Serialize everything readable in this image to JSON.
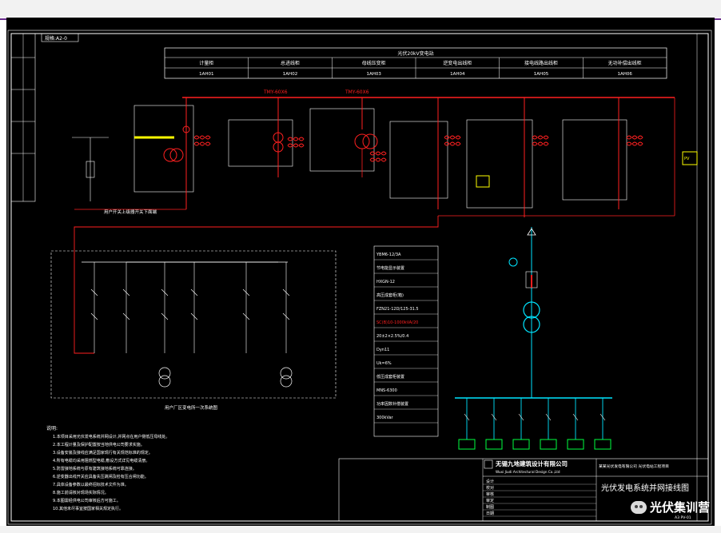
{
  "drawing": {
    "sheet_tag": "规格:A2-0",
    "header_title": "光伏20kV变电站",
    "cabinets": [
      {
        "name": "计量柜",
        "code": "1AH01"
      },
      {
        "name": "总进线柜",
        "code": "1AH02"
      },
      {
        "name": "母线压变柜",
        "code": "1AH03"
      },
      {
        "name": "逆变电出线柜",
        "code": "1AH04"
      },
      {
        "name": "接电线路出线柜",
        "code": "1AH05"
      },
      {
        "name": "无功补偿出线柜",
        "code": "1AH06"
      }
    ],
    "busbar_left_label": "TMY-60X6",
    "busbar_right_label": "TMY-60X6",
    "label_owner_switch": "用户开关上级器开关下面端",
    "label_owner_system": "用户厂区变电所一次系统图",
    "equipment_box_lines": [
      "YBM6-12/3A",
      "节电能显示装置",
      "HXGN-12",
      "高压成套柜(箱)",
      "FZN21-12D/125-31.5",
      "SC(B)10-1000kVA/20",
      "20±2×2.5%/0.4",
      "Dyn11",
      "Uk=6%",
      "低压成套柜装置",
      "MNS-6300",
      "功率因数补偿装置",
      "300kVar"
    ],
    "notes_title": "说明:",
    "notes": [
      "1.本项目采用光伏发电系统并网设计,并网点在用户侧低压母线处。",
      "2.本工程计量及保护配置按当地供电公司要求实施。",
      "3.设备安装及接线应满足国家现行有关规范标准的规定。",
      "4.所有电缆均采用阻燃型电缆,敷设方式详见电缆清册。",
      "5.防雷接地系统与原有建筑接地系统可靠连接。",
      "6.逆变器出线开关应具备失压跳闸及检有压合闸功能。",
      "7.具体设备参数以最终招标技术文件为准。",
      "8.施工前请核对现场实际情况。",
      "9.本图需经供电公司审核后方可施工。",
      "10.其他未尽事宜按国家相关规定执行。"
    ],
    "company_cn": "无锡九地建筑设计有限公司",
    "company_en": "Wuxi Jiudi Architectural Design Co.,Ltd",
    "client_project": "某某光伏发电有限公司 光伏电站工程项目",
    "drawing_title": "光伏发电系统并网接线图",
    "titleblock_fields": [
      "设计",
      "校对",
      "审核",
      "审定",
      "制图",
      "日期"
    ],
    "bottom_right_code": "A3 PV-01",
    "watermark": "光伏集训营"
  },
  "colors": {
    "background": "#000000",
    "red": "#ff2020",
    "white": "#ffffff",
    "cyan": "#00e5ff",
    "green": "#00ff40",
    "yellow": "#ffff00",
    "magenta": "#ff00ff"
  }
}
